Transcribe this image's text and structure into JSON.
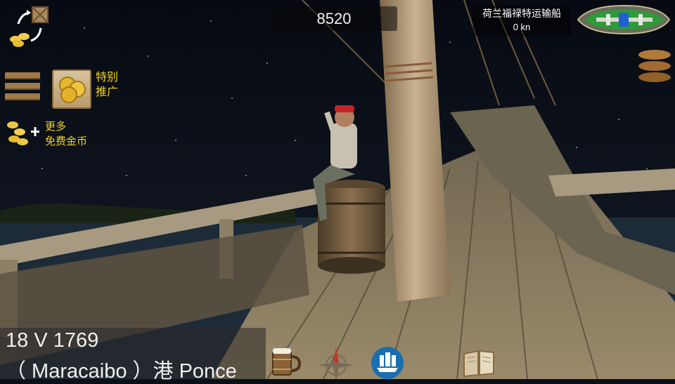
{
  "hud": {
    "gold": "8520",
    "ship_name": "荷兰福禄特运输船",
    "ship_speed": "0 kn",
    "promo_label_line1": "特别",
    "promo_label_line2": "推广",
    "free_gold_line1": "更多",
    "free_gold_line2": "免费金币"
  },
  "status": {
    "date": "18 V 1769",
    "port": "（ Maracaibo ）港 Ponce"
  },
  "icons": {
    "trade": "gold-exchange-icon",
    "menu": "hamburger-menu-icon",
    "promo": "gold-coins-icon",
    "free_gold": "add-gold-icon",
    "cargo": "barrels-icon",
    "tavern": "mug-icon",
    "navigation": "compass-icon",
    "fleet": "ship-icon",
    "logbook": "book-icon"
  },
  "colors": {
    "accent_yellow": "#f5d21c",
    "deck_wood": "#8a7a5c",
    "sky": "#0b0f18"
  }
}
